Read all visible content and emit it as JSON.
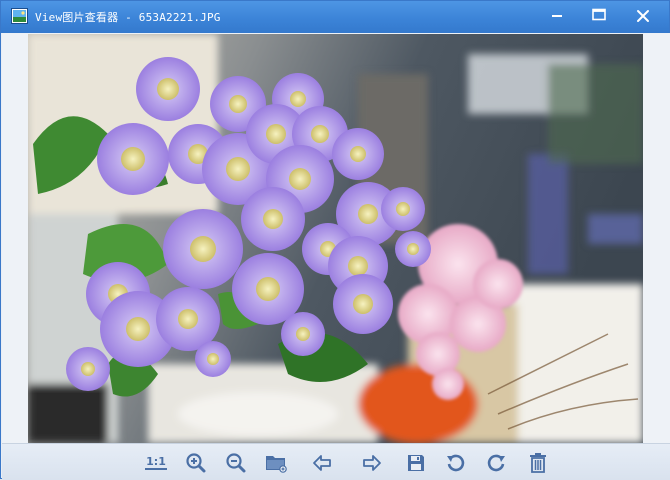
{
  "window": {
    "title": "View图片查看器 - 653A2221.JPG",
    "controls": [
      "minimize-icon",
      "maximize-icon",
      "close-icon"
    ]
  },
  "viewer": {
    "image_name": "653A2221.JPG",
    "image_description_icon": "photo"
  },
  "toolbar": {
    "actual_size_label": "1:1",
    "buttons": [
      {
        "name": "actual-size",
        "icon": "one-to-one-icon"
      },
      {
        "name": "zoom-in",
        "icon": "zoom-in-icon"
      },
      {
        "name": "zoom-out",
        "icon": "zoom-out-icon"
      },
      {
        "name": "open-folder",
        "icon": "folder-icon"
      },
      {
        "name": "previous",
        "icon": "arrow-left-icon"
      },
      {
        "name": "next",
        "icon": "arrow-right-icon"
      },
      {
        "name": "save",
        "icon": "save-icon"
      },
      {
        "name": "rotate-left",
        "icon": "rotate-ccw-icon"
      },
      {
        "name": "rotate-right",
        "icon": "rotate-cw-icon"
      },
      {
        "name": "delete",
        "icon": "trash-icon"
      }
    ]
  },
  "colors": {
    "titlebar": "#3c84d8",
    "toolbar_icon": "#4a6fa5",
    "flower_petal": "#a98ee6",
    "flower_center": "#e9e59a"
  }
}
